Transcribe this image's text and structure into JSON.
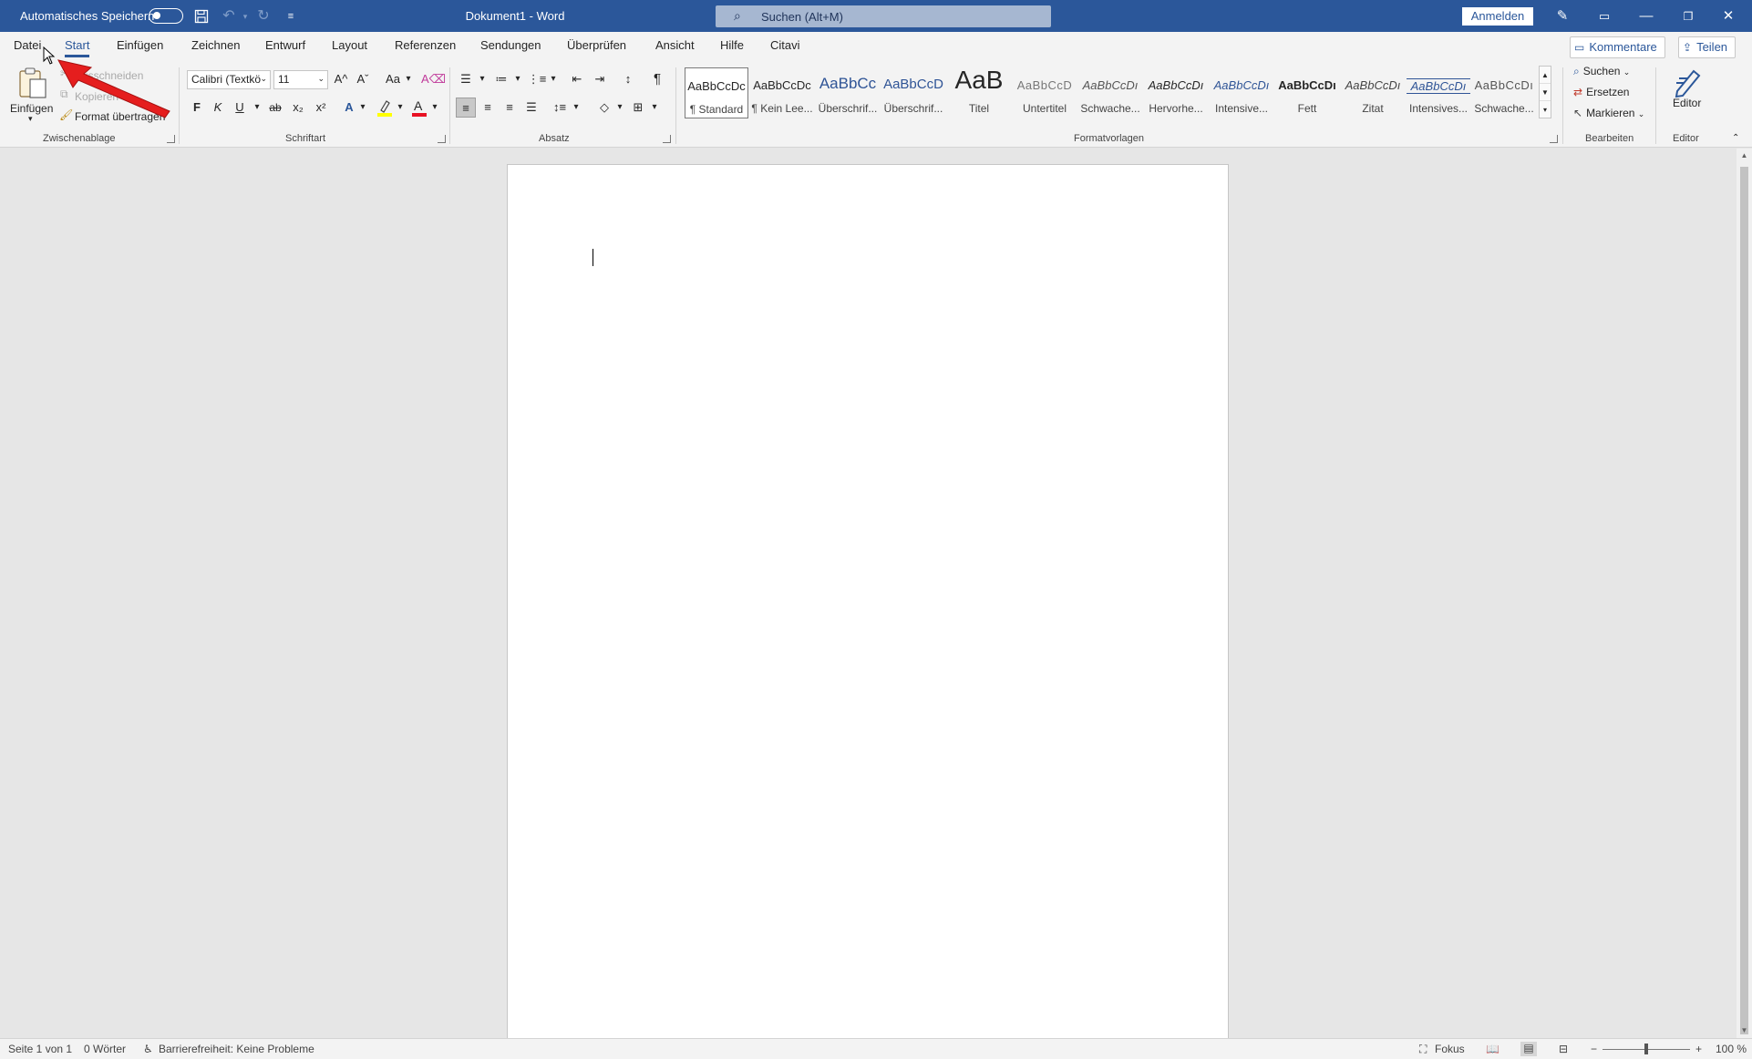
{
  "titlebar": {
    "autosave_label": "Automatisches Speichern",
    "doc_title": "Dokument1  -  Word",
    "search_placeholder": "Suchen (Alt+M)",
    "signin_label": "Anmelden"
  },
  "tabs": {
    "items": [
      "Datei",
      "Start",
      "Einfügen",
      "Zeichnen",
      "Entwurf",
      "Layout",
      "Referenzen",
      "Sendungen",
      "Überprüfen",
      "Ansicht",
      "Hilfe",
      "Citavi"
    ],
    "active": "Start",
    "comments_label": "Kommentare",
    "share_label": "Teilen"
  },
  "clipboard": {
    "paste_label": "Einfügen",
    "cut_label": "Ausschneiden",
    "copy_label": "Kopieren",
    "format_painter_label": "Format übertragen",
    "group_label": "Zwischenablage"
  },
  "font": {
    "family_value": "Calibri (Textkö",
    "size_value": "11",
    "bold_label": "F",
    "italic_label": "K",
    "underline_label": "U",
    "strike_label": "ab",
    "sub_label": "x₂",
    "sup_label": "x²",
    "change_case_label": "Aa",
    "grow_label": "A^",
    "shrink_label": "Aˇ",
    "group_label": "Schriftart"
  },
  "paragraph": {
    "group_label": "Absatz"
  },
  "styles": {
    "group_label": "Formatvorlagen",
    "items": [
      {
        "preview": "AaBbCcDc",
        "name": "¶ Standard"
      },
      {
        "preview": "AaBbCcDc",
        "name": "¶ Kein Lee..."
      },
      {
        "preview": "AaBbCc",
        "name": "Überschrif..."
      },
      {
        "preview": "AaBbCcD",
        "name": "Überschrif..."
      },
      {
        "preview": "AaB",
        "name": "Titel"
      },
      {
        "preview": "AaBbCcD",
        "name": "Untertitel"
      },
      {
        "preview": "AaBbCcDı",
        "name": "Schwache..."
      },
      {
        "preview": "AaBbCcDı",
        "name": "Hervorhe..."
      },
      {
        "preview": "AaBbCcDı",
        "name": "Intensive..."
      },
      {
        "preview": "AaBbCcDı",
        "name": "Fett"
      },
      {
        "preview": "AaBbCcDı",
        "name": "Zitat"
      },
      {
        "preview": "AaBbCcDı",
        "name": "Intensives..."
      },
      {
        "preview": "AaBbCcDı",
        "name": "Schwache..."
      }
    ]
  },
  "editing": {
    "find_label": "Suchen",
    "replace_label": "Ersetzen",
    "select_label": "Markieren",
    "group_label": "Bearbeiten"
  },
  "editor": {
    "button_label": "Editor",
    "group_label": "Editor"
  },
  "statusbar": {
    "page_info": "Seite 1 von 1",
    "words": "0 Wörter",
    "accessibility": "Barrierefreiheit: Keine Probleme",
    "focus_label": "Fokus",
    "zoom_value": "100 %"
  },
  "colors": {
    "brand": "#2b579a",
    "highlight": "#ffff00",
    "font_color": "#e81123",
    "annotation_arrow": "#e51e1e"
  }
}
